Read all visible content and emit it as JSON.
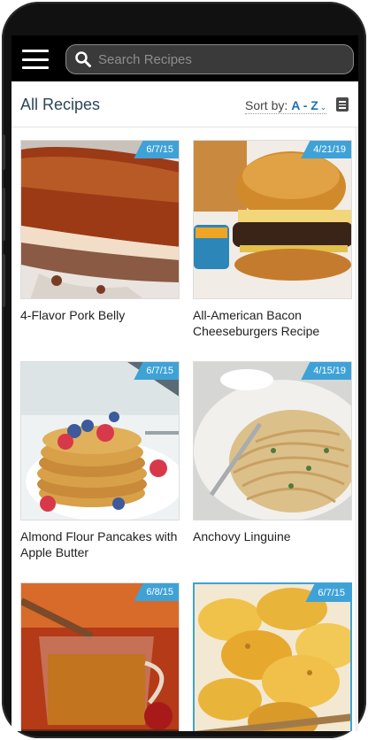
{
  "search": {
    "placeholder": "Search Recipes"
  },
  "header": {
    "title": "All Recipes",
    "sort_label": "Sort by:",
    "sort_value": "A - Z"
  },
  "recipes": [
    {
      "title": "4-Flavor Pork Belly",
      "date": "6/7/15"
    },
    {
      "title": "All-American Bacon Cheeseburgers Recipe",
      "date": "4/21/19"
    },
    {
      "title": "Almond Flour Pancakes with Apple Butter",
      "date": "6/7/15"
    },
    {
      "title": "Anchovy Linguine",
      "date": "4/15/19"
    },
    {
      "title": "",
      "date": "6/8/15"
    },
    {
      "title": "",
      "date": "6/7/15"
    }
  ],
  "colors": {
    "accent": "#3ea2d7",
    "title": "#2c4658",
    "sort_value": "#1f6fb5"
  },
  "icons": {
    "menu": "hamburger-icon",
    "search": "search-icon",
    "view": "list-view-icon"
  }
}
